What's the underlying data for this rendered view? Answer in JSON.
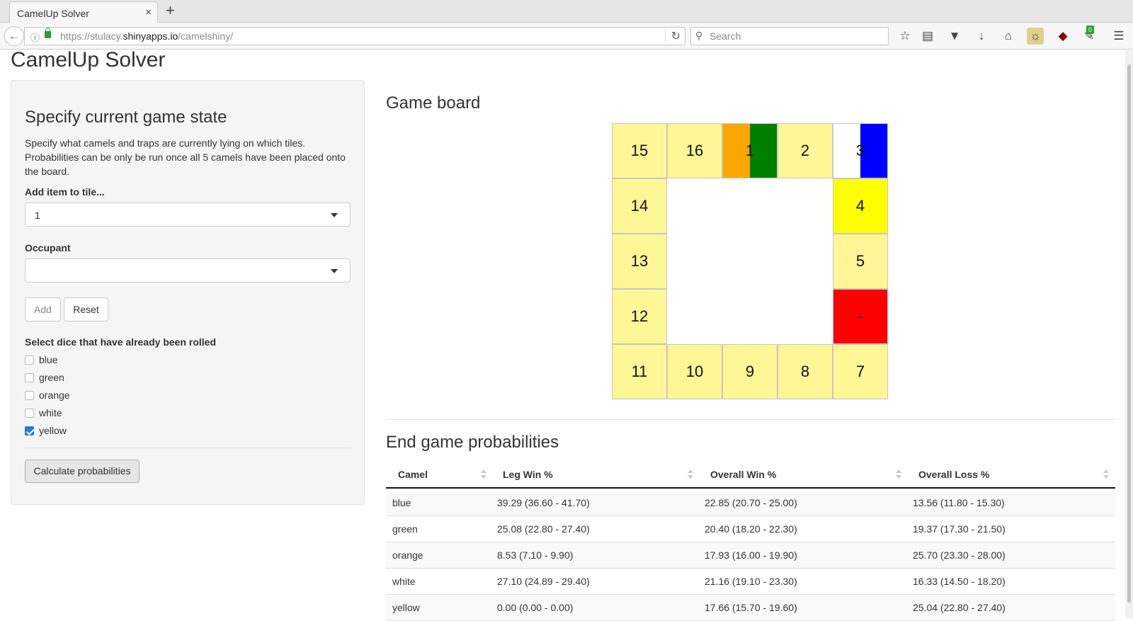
{
  "browser": {
    "tab_title": "CamelUp Solver",
    "close_glyph": "×",
    "new_tab_glyph": "+",
    "url_prefix": "https://stulacy.",
    "url_host": "shinyapps.io",
    "url_path": "/camelshiny/",
    "search_placeholder": "Search",
    "extension_badge": "0"
  },
  "app": {
    "title": "CamelUp Solver"
  },
  "sidebar": {
    "heading": "Specify current game state",
    "description": "Specify what camels and traps are currently lying on which tiles. Probabilities can be only be run once all 5 camels have been placed onto the board.",
    "tile_label": "Add item to tile...",
    "tile_value": "1",
    "occupant_label": "Occupant",
    "occupant_value": "",
    "add_button": "Add",
    "reset_button": "Reset",
    "dice_label": "Select dice that have already been rolled",
    "dice": [
      {
        "label": "blue",
        "checked": false
      },
      {
        "label": "green",
        "checked": false
      },
      {
        "label": "orange",
        "checked": false
      },
      {
        "label": "white",
        "checked": false
      },
      {
        "label": "yellow",
        "checked": true
      }
    ],
    "calculate_button": "Calculate probabilities"
  },
  "board": {
    "heading": "Game board",
    "tile_color": "#fff696",
    "tiles": [
      {
        "label": "15"
      },
      {
        "label": "16"
      },
      {
        "label": "1",
        "colors": [
          "#ffa500",
          "#008000"
        ]
      },
      {
        "label": "2"
      },
      {
        "label": "3",
        "colors": [
          "#ffffff",
          "#0000ff"
        ]
      },
      {
        "label": "14"
      },
      {
        "label": "4",
        "color": "#ffff00"
      },
      {
        "label": "13"
      },
      {
        "label": "5"
      },
      {
        "label": "12"
      },
      {
        "label": "-",
        "color": "#ff0000"
      },
      {
        "label": "11"
      },
      {
        "label": "10"
      },
      {
        "label": "9"
      },
      {
        "label": "8"
      },
      {
        "label": "7"
      }
    ]
  },
  "results": {
    "heading": "End game probabilities",
    "columns": [
      "Camel",
      "Leg Win %",
      "Overall Win %",
      "Overall Loss %"
    ],
    "rows": [
      [
        "blue",
        "39.29 (36.60 - 41.70)",
        "22.85 (20.70 - 25.00)",
        "13.56 (11.80 - 15.30)"
      ],
      [
        "green",
        "25.08 (22.80 - 27.40)",
        "20.40 (18.20 - 22.30)",
        "19.37 (17.30 - 21.50)"
      ],
      [
        "orange",
        "8.53 (7.10 - 9.90)",
        "17.93 (16.00 - 19.90)",
        "25.70 (23.30 - 28.00)"
      ],
      [
        "white",
        "27.10 (24.89 - 29.40)",
        "21.16 (19.10 - 23.30)",
        "16.33 (14.50 - 18.20)"
      ],
      [
        "yellow",
        "0.00 (0.00 - 0.00)",
        "17.66 (15.70 - 19.60)",
        "25.04 (22.80 - 27.40)"
      ]
    ]
  }
}
